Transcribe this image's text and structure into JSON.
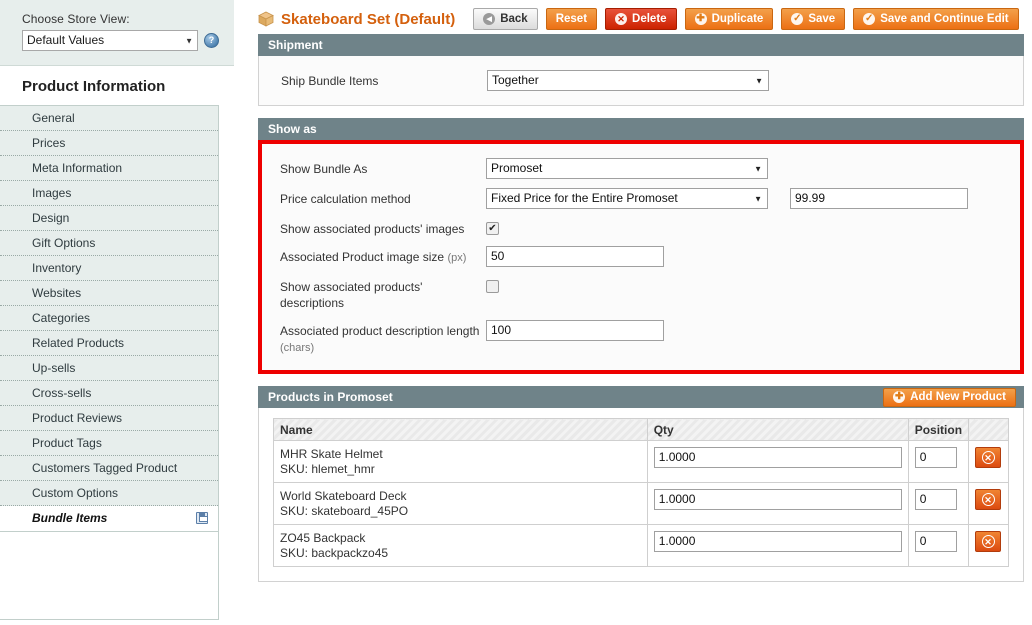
{
  "sidebar": {
    "store_view": {
      "label": "Choose Store View:",
      "value": "Default Values",
      "help_icon": "help-circle-icon",
      "caret": "▼"
    },
    "section_title": "Product Information",
    "items": [
      {
        "label": "General",
        "active": false
      },
      {
        "label": "Prices",
        "active": false
      },
      {
        "label": "Meta Information",
        "active": false
      },
      {
        "label": "Images",
        "active": false
      },
      {
        "label": "Design",
        "active": false
      },
      {
        "label": "Gift Options",
        "active": false
      },
      {
        "label": "Inventory",
        "active": false
      },
      {
        "label": "Websites",
        "active": false
      },
      {
        "label": "Categories",
        "active": false
      },
      {
        "label": "Related Products",
        "active": false
      },
      {
        "label": "Up-sells",
        "active": false
      },
      {
        "label": "Cross-sells",
        "active": false
      },
      {
        "label": "Product Reviews",
        "active": false
      },
      {
        "label": "Product Tags",
        "active": false
      },
      {
        "label": "Customers Tagged Product",
        "active": false
      },
      {
        "label": "Custom Options",
        "active": false
      },
      {
        "label": "Bundle Items",
        "active": true,
        "icon": "save-disk-icon"
      }
    ]
  },
  "header": {
    "title": "Skateboard Set (Default)",
    "title_icon": "bundle-box-icon",
    "buttons": [
      {
        "label": "Back",
        "style": "gray",
        "glyph": "◀"
      },
      {
        "label": "Reset",
        "style": "orange",
        "glyph": ""
      },
      {
        "label": "Delete",
        "style": "red",
        "glyph": "✕"
      },
      {
        "label": "Duplicate",
        "style": "orange",
        "glyph": "✚"
      },
      {
        "label": "Save",
        "style": "orange",
        "glyph": "✓"
      },
      {
        "label": "Save and Continue Edit",
        "style": "orange",
        "glyph": "✓"
      }
    ]
  },
  "shipment": {
    "heading": "Shipment",
    "ship_bundle_items": {
      "label": "Ship Bundle Items",
      "value": "Together",
      "caret": "▼"
    }
  },
  "show_as": {
    "heading": "Show as",
    "highlight_color": "#ee0000",
    "show_bundle_as": {
      "label": "Show Bundle As",
      "value": "Promoset",
      "caret": "▼"
    },
    "price_calculation": {
      "label": "Price calculation method",
      "value": "Fixed Price for the Entire Promoset",
      "caret": "▼",
      "price_value": "99.99"
    },
    "show_images": {
      "label": "Show associated products' images",
      "checked": true,
      "check_glyph": "✔"
    },
    "image_size": {
      "label": "Associated Product image size",
      "label_suffix": "(px)",
      "value": "50"
    },
    "show_descriptions": {
      "label": "Show associated products' descriptions",
      "checked": false,
      "check_glyph": ""
    },
    "description_length": {
      "label": "Associated product description length",
      "label_suffix": "(chars)",
      "value": "100"
    }
  },
  "products_grid": {
    "heading": "Products in Promoset",
    "add_button": {
      "label": "Add New Product",
      "glyph": "✚"
    },
    "columns": [
      "Name",
      "Qty",
      "Position",
      ""
    ],
    "rows": [
      {
        "name": "MHR Skate Helmet",
        "sku_label": "SKU:",
        "sku": "hlemet_hmr",
        "qty": "1.0000",
        "position": "0",
        "delete_glyph": "✕"
      },
      {
        "name": "World Skateboard Deck",
        "sku_label": "SKU:",
        "sku": "skateboard_45PO",
        "qty": "1.0000",
        "position": "0",
        "delete_glyph": "✕"
      },
      {
        "name": "ZO45 Backpack",
        "sku_label": "SKU:",
        "sku": "backpackzo45",
        "qty": "1.0000",
        "position": "0",
        "delete_glyph": "✕"
      }
    ]
  }
}
